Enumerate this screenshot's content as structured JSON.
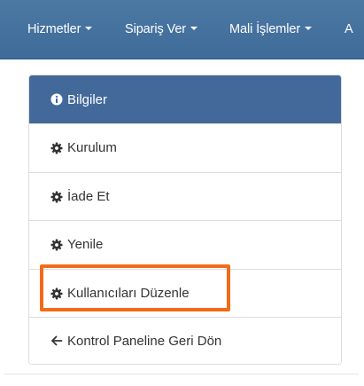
{
  "navbar": {
    "items": [
      {
        "label": "Hizmetler"
      },
      {
        "label": "Sipariş Ver"
      },
      {
        "label": "Mali İşlemler"
      },
      {
        "label": "A"
      }
    ]
  },
  "panel": {
    "heading": {
      "label": "Bilgiler",
      "icon": "info-circle-icon"
    },
    "items": [
      {
        "label": "Kurulum",
        "icon": "gear-icon"
      },
      {
        "label": "İade Et",
        "icon": "gear-icon"
      },
      {
        "label": "Yenile",
        "icon": "gear-icon"
      },
      {
        "label": "Kullanıcıları Düzenle",
        "icon": "gear-icon"
      },
      {
        "label": "Kontrol Paneline Geri Dön",
        "icon": "arrow-left-icon"
      }
    ]
  },
  "colors": {
    "navbar": "#4a75a1",
    "panel_heading": "#42699a",
    "highlight": "#f26a1b",
    "text": "#333333"
  }
}
